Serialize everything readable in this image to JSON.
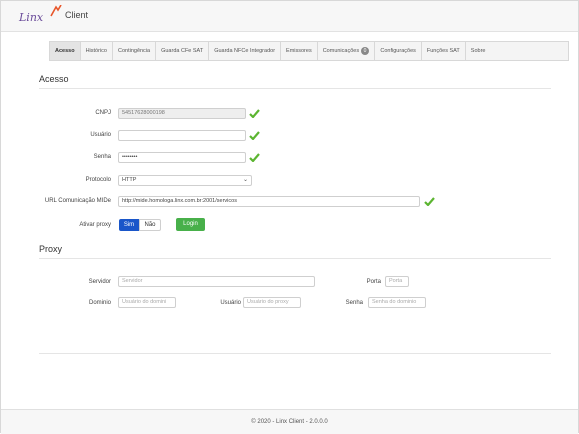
{
  "header": {
    "logo_word": "Linx",
    "app_name": "Client"
  },
  "tabs": [
    {
      "label": "Acesso"
    },
    {
      "label": "Histórico"
    },
    {
      "label": "Contingência"
    },
    {
      "label": "Guarda CFe SAT"
    },
    {
      "label": "Guarda NFCe Integrador"
    },
    {
      "label": "Emissores"
    },
    {
      "label": "Comunicações",
      "badge": "0"
    },
    {
      "label": "Configurações"
    },
    {
      "label": "Funções SAT"
    },
    {
      "label": "Sobre"
    }
  ],
  "acesso": {
    "title": "Acesso",
    "cnpj_label": "CNPJ",
    "cnpj_value": "54517628000198",
    "usuario_label": "Usuário",
    "usuario_value": "",
    "senha_label": "Senha",
    "senha_value": "••••••••",
    "protocolo_label": "Protocolo",
    "protocolo_value": "HTTP",
    "url_label": "URL Comunicação MIDe",
    "url_value": "http://mide.homologa.linx.com.br:2001/servicos",
    "proxy_label": "Ativar proxy",
    "sim": "Sim",
    "nao": "Não",
    "login": "Login"
  },
  "proxy": {
    "title": "Proxy",
    "servidor_label": "Servidor",
    "servidor_placeholder": "Servidor",
    "porta_label": "Porta",
    "porta_placeholder": "Porta",
    "dominio_label": "Dominio",
    "dominio_placeholder": "Usuário do domini",
    "usuario_label": "Usuário",
    "usuario_placeholder": "Usuário do proxy",
    "senha_label": "Senha",
    "senha_placeholder": "Senha do dominio"
  },
  "footer": {
    "text": "© 2020 - Linx Client - 2.0.0.0"
  },
  "colors": {
    "primary": "#1a56c9",
    "success": "#48b04a",
    "check": "#5cb531"
  }
}
